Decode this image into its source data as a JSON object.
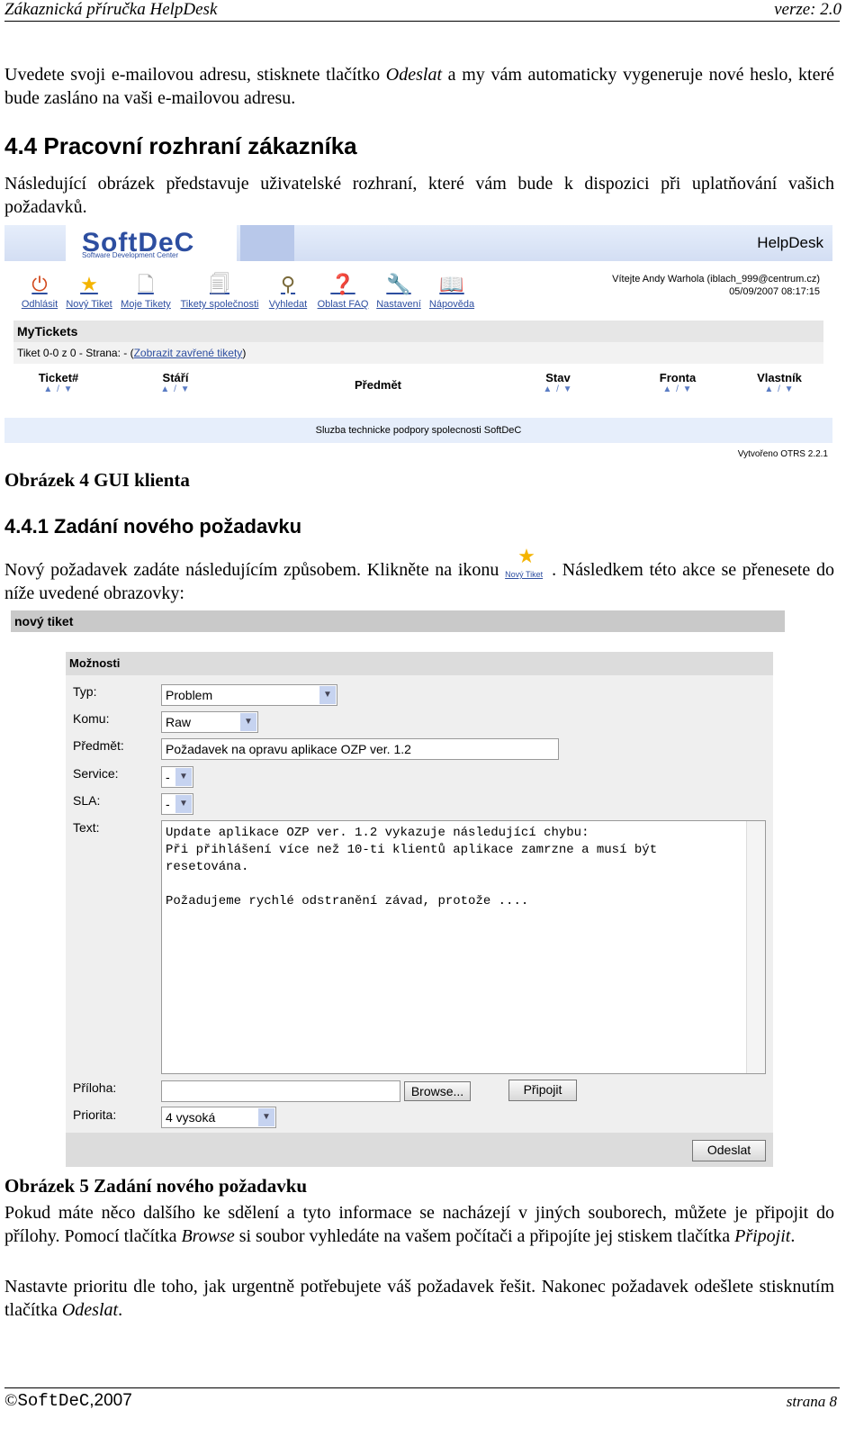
{
  "header": {
    "left": "Zákaznická příručka HelpDesk",
    "right": "verze: 2.0"
  },
  "intro": {
    "part1": "Uvedete svoji e-mailovou adresu, stisknete tlačítko ",
    "italic": "Odeslat",
    "part2": " a my vám automaticky vygeneruje nové heslo, které bude zasláno na vaši e-mailovou adresu."
  },
  "section": {
    "title": "4.4 Pracovní rozhraní zákazníka",
    "text": "Následující obrázek představuje uživatelské rozhraní, které vám bude k dispozici při uplatňování vašich požadavků."
  },
  "gui1": {
    "logo": "SoftDeC",
    "logo_sub": "Software Development Center",
    "app": "HelpDesk",
    "welcome": "Vítejte Andy Warhola (iblach_999@centrum.cz)",
    "datetime": "05/09/2007 08:17:15",
    "tools": [
      {
        "label": "Odhlásit",
        "icon": "logout-icon"
      },
      {
        "label": "Nový Tiket",
        "icon": "star-icon"
      },
      {
        "label": "Moje Tikety",
        "icon": "document-icon"
      },
      {
        "label": "Tikety společnosti",
        "icon": "documents-icon"
      },
      {
        "label": "Vyhledat",
        "icon": "search-icon"
      },
      {
        "label": "Oblast FAQ",
        "icon": "help-icon"
      },
      {
        "label": "Nastavení",
        "icon": "tools-icon"
      },
      {
        "label": "Nápověda",
        "icon": "book-icon"
      }
    ],
    "mytickets": "MyTickets",
    "subline_prefix": "Tiket 0-0 z 0 - Strana: - (",
    "subline_link": "Zobrazit zavřené tikety",
    "subline_suffix": ")",
    "columns": [
      "Ticket#",
      "Stáří",
      "Předmět",
      "Stav",
      "Fronta",
      "Vlastník"
    ],
    "sort_symbol": "▲ / ▼",
    "footer": "Sluzba technicke podpory spolecnosti SoftDeC",
    "created": "Vytvořeno OTRS 2.2.1"
  },
  "caption1": "Obrázek 4 GUI klienta",
  "subsection": {
    "title": "4.4.1 Zadání nového požadavku",
    "text_before": "Nový požadavek zadáte následujícím způsobem. Klikněte na ikonu ",
    "icon_label": "Nový Tiket",
    "text_after": ". Následkem této akce se přenesete do níže uvedené obrazovky:"
  },
  "gui2": {
    "bar_title": "nový tiket",
    "options_title": "Možnosti",
    "labels": {
      "typ": "Typ:",
      "komu": "Komu:",
      "predmet": "Předmět:",
      "service": "Service:",
      "sla": "SLA:",
      "text": "Text:",
      "priloha": "Příloha:",
      "priorita": "Priorita:"
    },
    "values": {
      "typ": "Problem",
      "komu": "Raw",
      "predmet": "Požadavek na opravu aplikace OZP ver. 1.2",
      "service": "-",
      "sla": "-",
      "text": "Update aplikace OZP ver. 1.2 vykazuje následující chybu:\nPři přihlášení více než 10-ti klientů aplikace zamrzne a musí být resetována.\n\nPožadujeme rychlé odstranění závad, protože ....",
      "priorita": "4 vysoká"
    },
    "buttons": {
      "browse": "Browse...",
      "attach": "Připojit",
      "send": "Odeslat"
    }
  },
  "caption2": "Obrázek 5 Zadání nového požadavku",
  "para2": {
    "p1": "Pokud máte něco dalšího ke sdělení  a tyto informace se nacházejí v jiných souborech, můžete je připojit do přílohy. Pomocí tlačítka ",
    "i1": "Browse",
    "p2": " si soubor vyhledáte na vašem počítači a připojíte jej stiskem tlačítka ",
    "i2": "Připojit",
    "p3": "."
  },
  "para3": {
    "p1": "Nastavte prioritu dle toho, jak urgentně potřebujete váš požadavek řešit. Nakonec požadavek odešlete stisknutím tlačítka ",
    "i1": "Odeslat",
    "p2": "."
  },
  "footer": {
    "copyright": "©",
    "company": "SoftDeC",
    "year": ",2007",
    "page": "strana 8"
  }
}
